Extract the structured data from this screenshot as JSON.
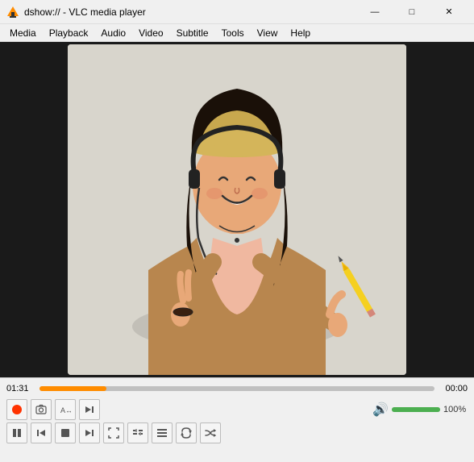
{
  "window": {
    "title": "dshow:// - VLC media player",
    "icon": "▶",
    "controls": {
      "minimize": "—",
      "maximize": "□",
      "close": "✕"
    }
  },
  "menu": {
    "items": [
      "Media",
      "Playback",
      "Audio",
      "Video",
      "Subtitle",
      "Tools",
      "View",
      "Help"
    ]
  },
  "player": {
    "time_current": "01:31",
    "time_total": "00:00",
    "volume_pct": "100%",
    "seek_pct": 16.9,
    "volume_fill_pct": 100
  },
  "controls_row1": {
    "record": "⏺",
    "snapshot": "📷",
    "loop_ab": "↔",
    "frame_next": "⏭"
  },
  "controls_row2": {
    "play_pause": "⏸",
    "prev": "⏮",
    "stop": "⏹",
    "next": "⏭",
    "fullscreen": "⛶",
    "extended": "≡",
    "playlist": "☰",
    "loop": "↺",
    "random": "⇄"
  }
}
